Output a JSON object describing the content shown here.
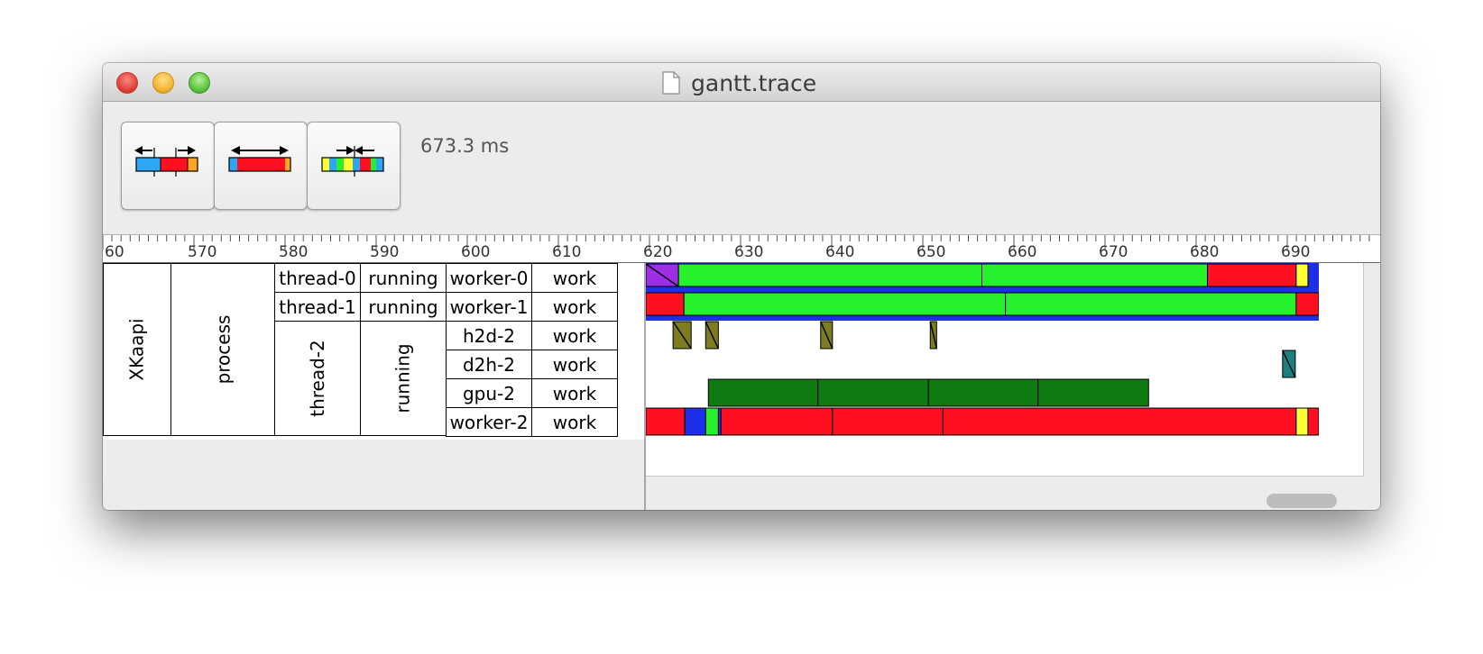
{
  "window": {
    "title": "gantt.trace"
  },
  "toolbar": {
    "buttons": [
      {
        "name": "zoom-out-button"
      },
      {
        "name": "fit-button"
      },
      {
        "name": "zoom-in-button"
      }
    ],
    "duration": "673.3 ms"
  },
  "ruler": {
    "labels": [
      "60",
      "570",
      "580",
      "590",
      "600",
      "610",
      "620",
      "630",
      "640",
      "650",
      "660",
      "670",
      "680",
      "690"
    ]
  },
  "hierarchy": {
    "root": "XKaapi",
    "process": "process",
    "threads": [
      {
        "name": "thread-0",
        "state": "running",
        "workers": [
          {
            "name": "worker-0",
            "state": "work"
          }
        ]
      },
      {
        "name": "thread-1",
        "state": "running",
        "workers": [
          {
            "name": "worker-1",
            "state": "work"
          }
        ]
      },
      {
        "name": "thread-2",
        "state": "running",
        "workers": [
          {
            "name": "h2d-2",
            "state": "work"
          },
          {
            "name": "d2h-2",
            "state": "work"
          },
          {
            "name": "gpu-2",
            "state": "work"
          },
          {
            "name": "worker-2",
            "state": "work"
          }
        ]
      }
    ]
  },
  "chart_data": {
    "type": "gantt",
    "x_unit": "ms",
    "xlim": [
      616.3,
      690.6
    ],
    "colors": {
      "blue": "#1d2fe8",
      "red": "#ff1020",
      "lime": "#27f02d",
      "purple": "#9d2ee6",
      "yellow": "#ffff33",
      "olive": "#7e7b20",
      "teal": "#1c8083",
      "darkgreen": "#0f7a12"
    },
    "rows": [
      {
        "label": "worker-0",
        "segments": [
          {
            "start": 616.3,
            "end": 690.6,
            "color": "blue",
            "layer": "base"
          },
          {
            "start": 616.3,
            "end": 619.9,
            "color": "purple",
            "hatch": true
          },
          {
            "start": 619.9,
            "end": 653.4,
            "color": "lime"
          },
          {
            "start": 653.4,
            "end": 678.3,
            "color": "lime"
          },
          {
            "start": 678.3,
            "end": 688.1,
            "color": "red"
          },
          {
            "start": 688.1,
            "end": 689.4,
            "color": "yellow"
          }
        ]
      },
      {
        "label": "worker-1",
        "segments": [
          {
            "start": 616.3,
            "end": 690.6,
            "color": "blue",
            "layer": "base"
          },
          {
            "start": 616.3,
            "end": 620.5,
            "color": "red"
          },
          {
            "start": 620.5,
            "end": 656.0,
            "color": "lime"
          },
          {
            "start": 656.0,
            "end": 688.1,
            "color": "lime"
          },
          {
            "start": 688.1,
            "end": 690.6,
            "color": "red"
          }
        ]
      },
      {
        "label": "h2d-2",
        "segments": [
          {
            "start": 619.3,
            "end": 621.3,
            "color": "olive",
            "hatch": true
          },
          {
            "start": 622.9,
            "end": 624.3,
            "color": "olive",
            "hatch": true
          },
          {
            "start": 635.6,
            "end": 636.9,
            "color": "olive",
            "hatch": true
          },
          {
            "start": 647.7,
            "end": 648.4,
            "color": "olive",
            "hatch": true
          }
        ]
      },
      {
        "label": "d2h-2",
        "segments": [
          {
            "start": 686.6,
            "end": 688.0,
            "color": "teal",
            "hatch": true
          }
        ]
      },
      {
        "label": "gpu-2",
        "segments": [
          {
            "start": 623.2,
            "end": 635.3,
            "color": "darkgreen"
          },
          {
            "start": 635.3,
            "end": 647.5,
            "color": "darkgreen"
          },
          {
            "start": 647.5,
            "end": 659.6,
            "color": "darkgreen"
          },
          {
            "start": 659.6,
            "end": 671.8,
            "color": "darkgreen"
          }
        ]
      },
      {
        "label": "worker-2",
        "segments": [
          {
            "start": 616.3,
            "end": 620.6,
            "color": "red"
          },
          {
            "start": 620.6,
            "end": 624.6,
            "color": "blue"
          },
          {
            "start": 622.9,
            "end": 624.3,
            "color": "lime"
          },
          {
            "start": 624.6,
            "end": 636.9,
            "color": "red"
          },
          {
            "start": 636.9,
            "end": 649.1,
            "color": "red"
          },
          {
            "start": 649.1,
            "end": 688.1,
            "color": "red"
          },
          {
            "start": 688.1,
            "end": 689.4,
            "color": "yellow"
          },
          {
            "start": 689.4,
            "end": 690.6,
            "color": "red"
          }
        ]
      }
    ]
  }
}
